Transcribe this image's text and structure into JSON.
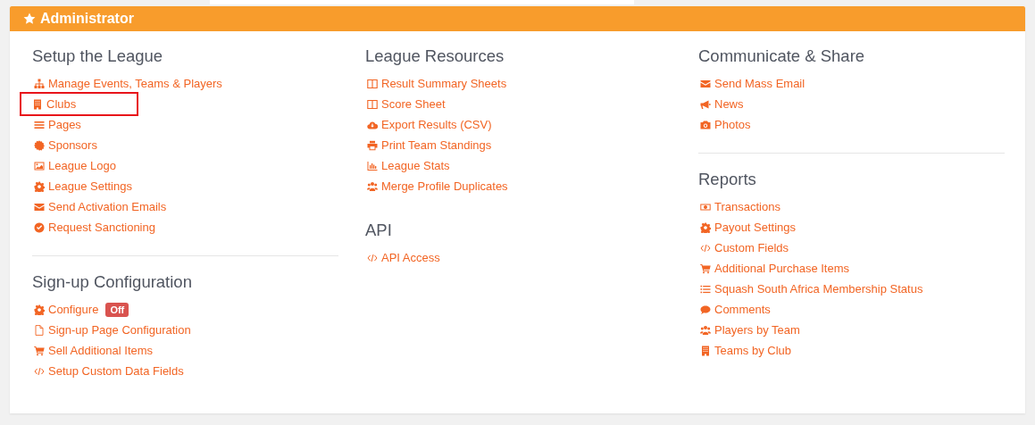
{
  "panel": {
    "title": "Administrator",
    "columns": [
      {
        "sections": [
          {
            "title": "Setup the League",
            "items": [
              {
                "label": "Manage Events, Teams & Players",
                "kind": "sitemap",
                "highlighted": false
              },
              {
                "label": "Clubs",
                "kind": "building",
                "highlighted": true
              },
              {
                "label": "Pages",
                "kind": "bars",
                "highlighted": false
              },
              {
                "label": "Sponsors",
                "kind": "certificate",
                "highlighted": false
              },
              {
                "label": "League Logo",
                "kind": "image",
                "highlighted": false
              },
              {
                "label": "League Settings",
                "kind": "cog",
                "highlighted": false
              },
              {
                "label": "Send Activation Emails",
                "kind": "envelope",
                "highlighted": false
              },
              {
                "label": "Request Sanctioning",
                "kind": "check",
                "highlighted": false
              }
            ]
          },
          {
            "title": "Sign-up Configuration",
            "items": [
              {
                "label": "Configure",
                "kind": "cog",
                "highlighted": false,
                "badge": "Off"
              },
              {
                "label": "Sign-up Page Configuration",
                "kind": "file",
                "highlighted": false
              },
              {
                "label": "Sell Additional Items",
                "kind": "cart",
                "highlighted": false
              },
              {
                "label": "Setup Custom Data Fields",
                "kind": "code",
                "highlighted": false
              }
            ]
          }
        ]
      },
      {
        "sections": [
          {
            "title": "League Resources",
            "items": [
              {
                "label": "Result Summary Sheets",
                "kind": "columns",
                "highlighted": false
              },
              {
                "label": "Score Sheet",
                "kind": "columns",
                "highlighted": false
              },
              {
                "label": "Export Results (CSV)",
                "kind": "cloud",
                "highlighted": false
              },
              {
                "label": "Print Team Standings",
                "kind": "print",
                "highlighted": false
              },
              {
                "label": "League Stats",
                "kind": "chart",
                "highlighted": false
              },
              {
                "label": "Merge Profile Duplicates",
                "kind": "users",
                "highlighted": false
              }
            ]
          },
          {
            "title": "API",
            "items": [
              {
                "label": "API Access",
                "kind": "code",
                "highlighted": false
              }
            ]
          }
        ]
      },
      {
        "sections": [
          {
            "title": "Communicate & Share",
            "items": [
              {
                "label": "Send Mass Email",
                "kind": "envelope",
                "highlighted": false
              },
              {
                "label": "News",
                "kind": "bullhorn",
                "highlighted": false
              },
              {
                "label": "Photos",
                "kind": "camera",
                "highlighted": false
              }
            ]
          },
          {
            "title": "Reports",
            "items": [
              {
                "label": "Transactions",
                "kind": "money",
                "highlighted": false
              },
              {
                "label": "Payout Settings",
                "kind": "cog",
                "highlighted": false
              },
              {
                "label": "Custom Fields",
                "kind": "code",
                "highlighted": false
              },
              {
                "label": "Additional Purchase Items",
                "kind": "cart",
                "highlighted": false
              },
              {
                "label": "Squash South Africa Membership Status",
                "kind": "list",
                "highlighted": false
              },
              {
                "label": "Comments",
                "kind": "comment",
                "highlighted": false
              },
              {
                "label": "Players by Team",
                "kind": "users",
                "highlighted": false
              },
              {
                "label": "Teams by Club",
                "kind": "building",
                "highlighted": false
              }
            ]
          }
        ]
      }
    ]
  }
}
